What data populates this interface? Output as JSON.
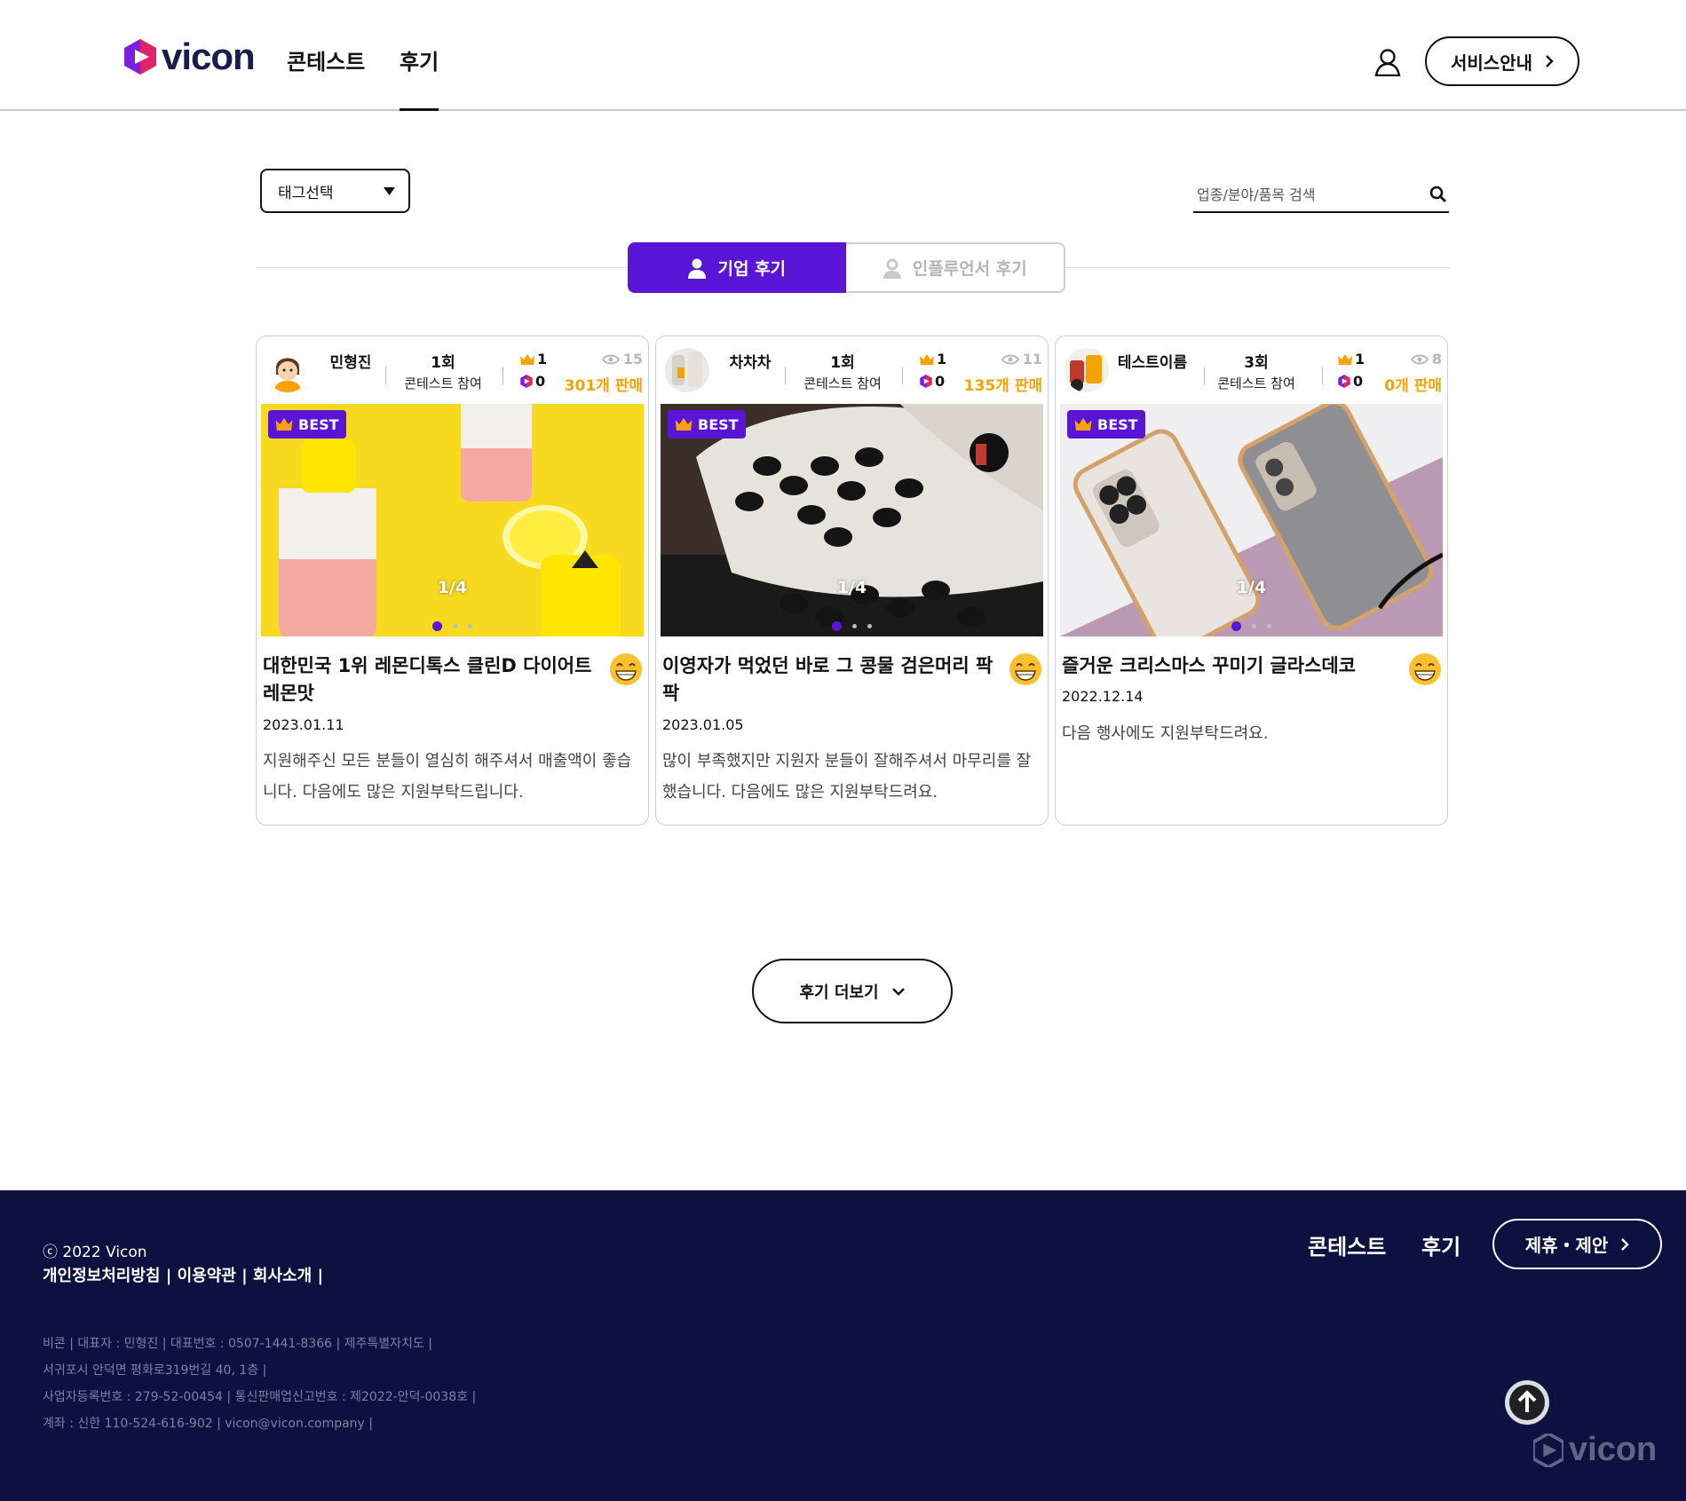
{
  "header": {
    "brand": "vicon",
    "nav": [
      {
        "label": "콘테스트"
      },
      {
        "label": "후기"
      }
    ],
    "service_label": "서비스안내"
  },
  "filters": {
    "tag_select": "태그선택",
    "search_placeholder": "업종/분야/품목 검색"
  },
  "tabs": [
    {
      "label": "기업 후기",
      "active": true
    },
    {
      "label": "인플루언서 후기",
      "active": false
    }
  ],
  "cards": [
    {
      "name": "민형진",
      "count": "1회",
      "count_label": "콘테스트 참여",
      "crown_count": "1",
      "vicon_count": "0",
      "views": "15",
      "sold": "301개 판매",
      "badge": "BEST",
      "counter": "1/4",
      "title": "대한민국 1위 레몬디톡스 클린D 다이어트 레몬맛",
      "date": "2023.01.11",
      "body": "지원해주신 모든 분들이 열심히 해주셔서 매출액이 좋습니다. 다음에도 많은 지원부탁드립니다."
    },
    {
      "name": "차차차",
      "count": "1회",
      "count_label": "콘테스트 참여",
      "crown_count": "1",
      "vicon_count": "0",
      "views": "11",
      "sold": "135개 판매",
      "badge": "BEST",
      "counter": "1/4",
      "title": "이영자가 먹었던 바로 그 콩물 검은머리 팍팍",
      "date": "2023.01.05",
      "body": "많이 부족했지만 지원자 분들이 잘해주셔서 마무리를 잘했습니다. 다음에도 많은 지원부탁드려요."
    },
    {
      "name": "테스트이름",
      "count": "3회",
      "count_label": "콘테스트 참여",
      "crown_count": "1",
      "vicon_count": "0",
      "views": "8",
      "sold": "0개 판매",
      "badge": "BEST",
      "counter": "1/4",
      "title": "즐거운 크리스마스 꾸미기 글라스데코",
      "date": "2022.12.14",
      "body": "다음 행사에도 지원부탁드려요."
    }
  ],
  "more_label": "후기 더보기",
  "footer": {
    "copyright": "ⓒ 2022 Vicon",
    "links": "개인정보처리방침 | 이용약관 | 회사소개 |",
    "info": [
      "비콘 | 대표자 : 민형진 | 대표번호 : 0507-1441-8366 | 제주특별자치도 |",
      "서귀포시 안덕면 평화로319번길 40, 1층 |",
      "사업자등록번호 : 279-52-00454 | 통신판매업신고번호 : 제2022-안덕-0038호 |",
      "계좌 : 신한 110-524-616-902 | vicon@vicon.company |"
    ],
    "nav": [
      {
        "label": "콘테스트"
      },
      {
        "label": "후기"
      }
    ],
    "partner_label": "제휴・제안",
    "brand": "vicon"
  },
  "colors": {
    "accent": "#5a14d6",
    "footer_bg": "#0d1140",
    "sold": "#f5a300"
  }
}
